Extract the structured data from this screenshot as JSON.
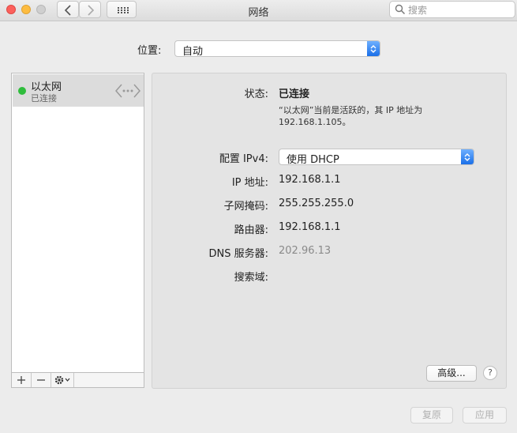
{
  "window": {
    "title": "网络"
  },
  "search": {
    "placeholder": "搜索"
  },
  "location": {
    "label": "位置:",
    "value": "自动"
  },
  "sidebar": {
    "services": [
      {
        "name": "以太网",
        "status": "已连接",
        "status_color": "#2fbd3c"
      }
    ]
  },
  "detail": {
    "status_label": "状态:",
    "status_value": "已连接",
    "status_desc_line1": "“以太网”当前是活跃的，其 IP 地址为",
    "status_desc_line2": "192.168.1.105。",
    "config_label": "配置 IPv4:",
    "config_value": "使用 DHCP",
    "ip_label": "IP 地址:",
    "ip_value": "192.168.1.1",
    "subnet_label": "子网掩码:",
    "subnet_value": "255.255.255.0",
    "router_label": "路由器:",
    "router_value": "192.168.1.1",
    "dns_label": "DNS 服务器:",
    "dns_value": "202.96.13",
    "search_domain_label": "搜索域:"
  },
  "buttons": {
    "advanced": "高级...",
    "help": "?",
    "revert": "复原",
    "apply": "应用"
  },
  "colors": {
    "accent": "#1a6fe8",
    "close": "#fc605c",
    "minimize": "#fdbc40",
    "zoom": "#c8c8c8"
  }
}
